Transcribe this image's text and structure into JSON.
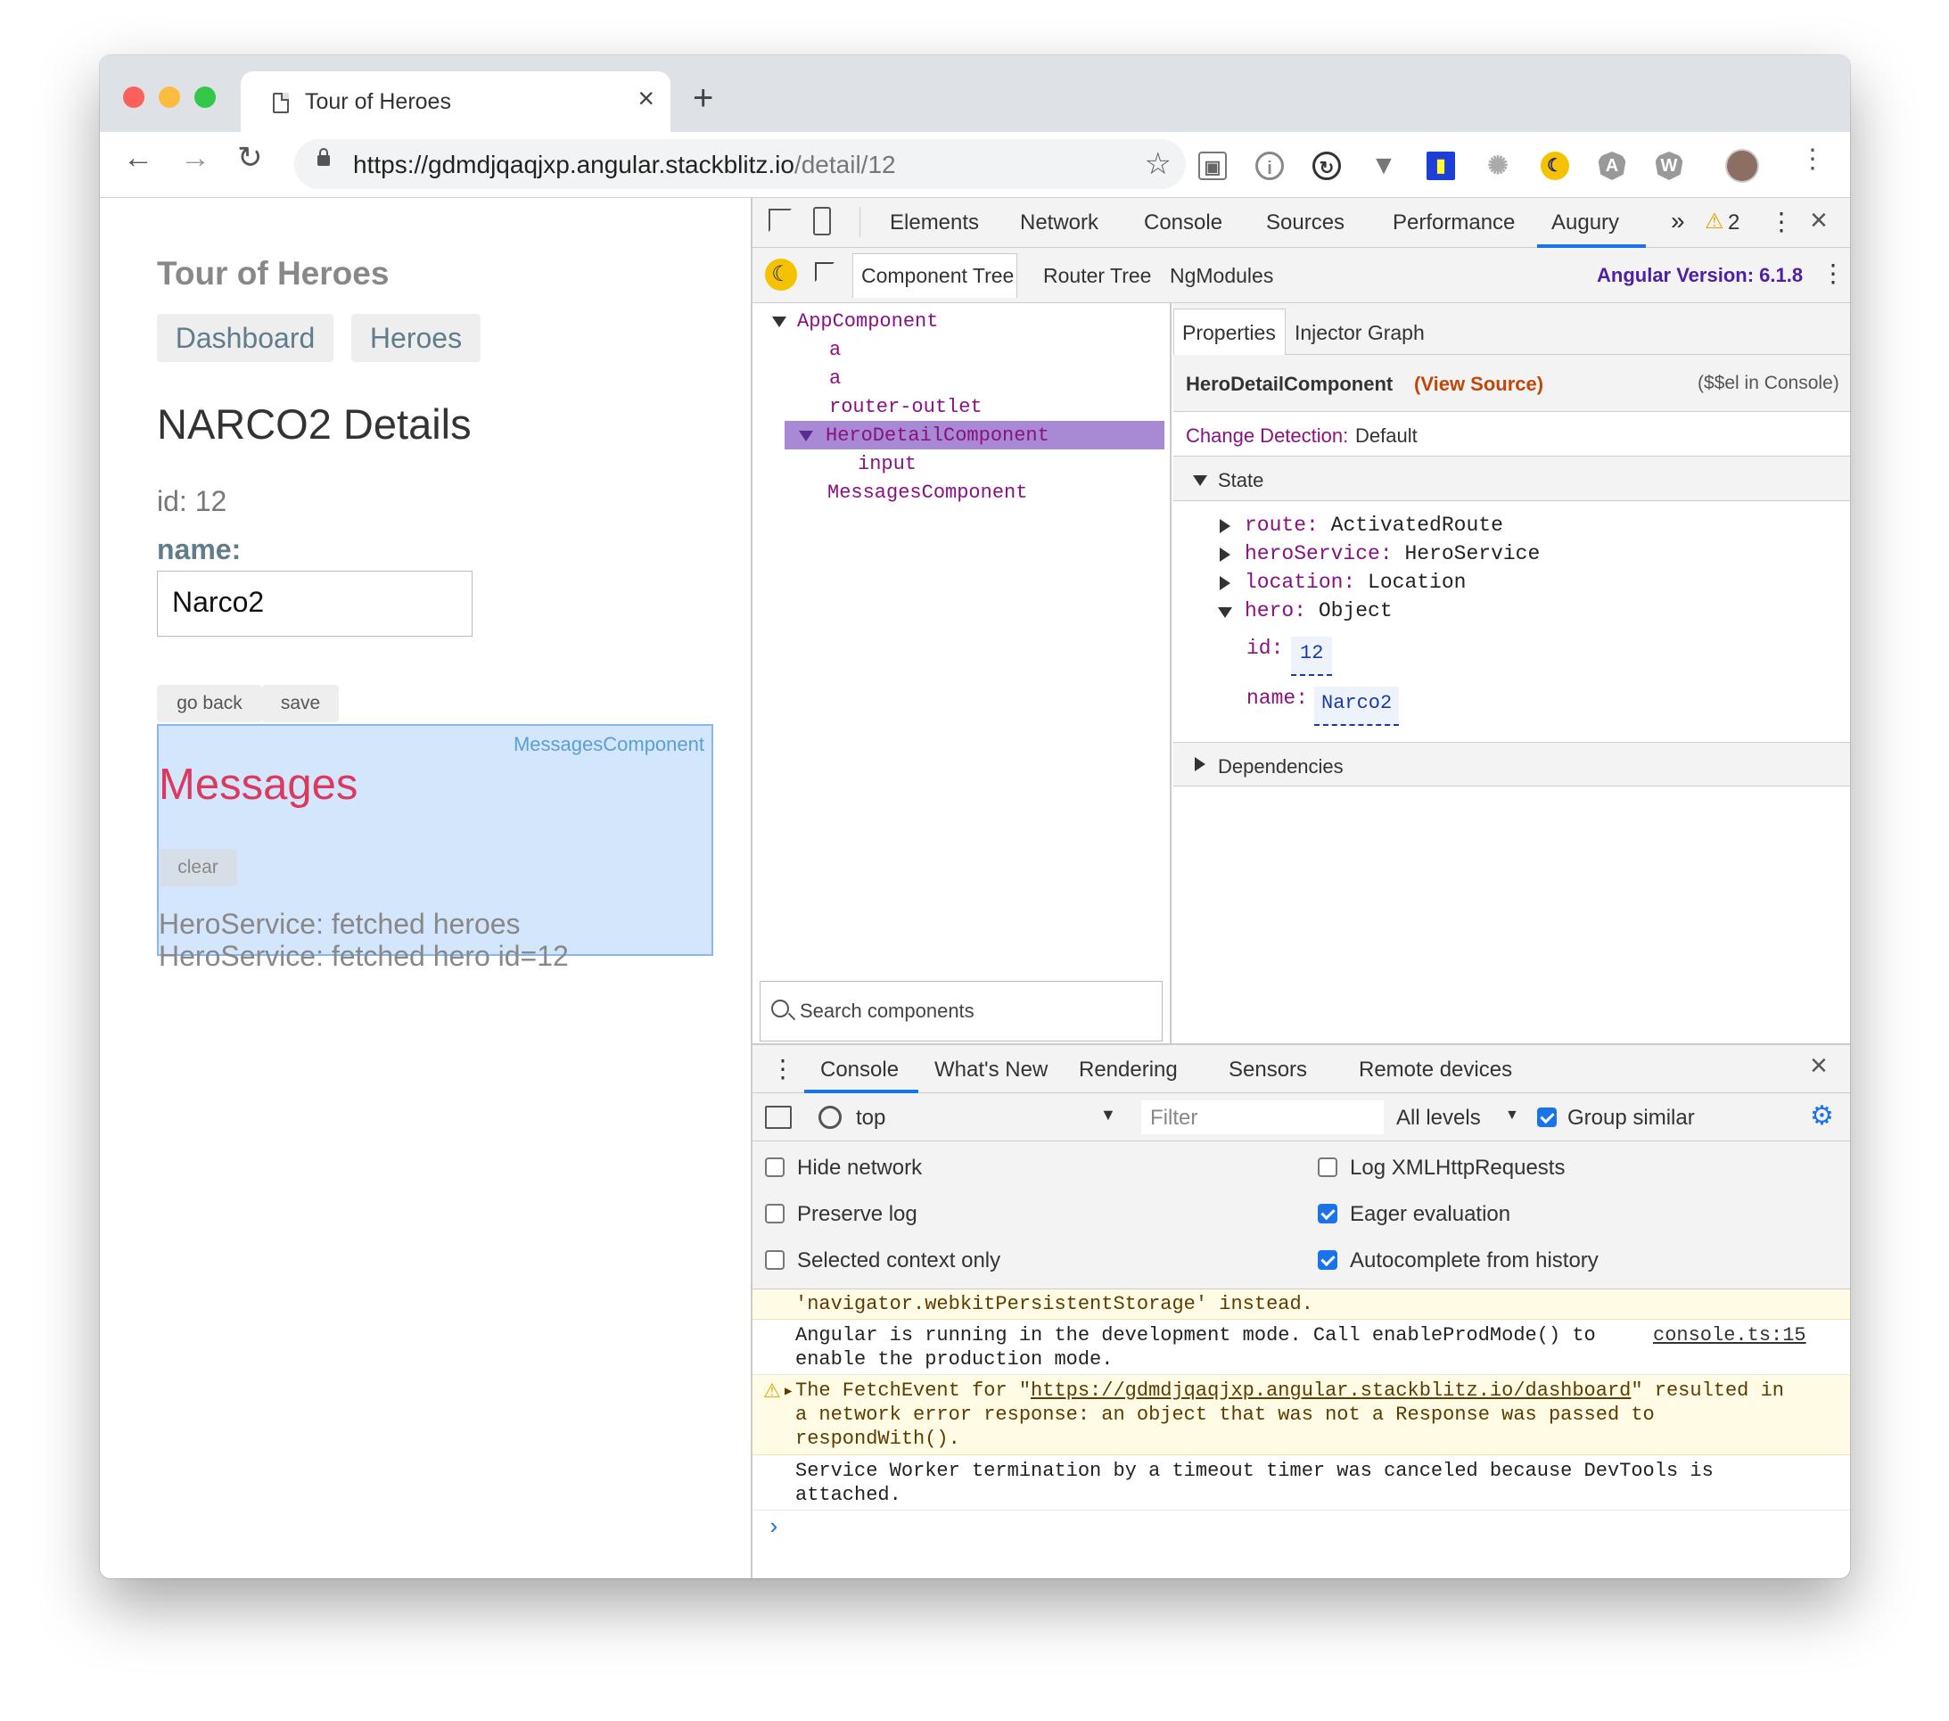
{
  "browser": {
    "tab_title": "Tour of Heroes",
    "url_main": "https://gdmdjqaqjxp.angular.stackblitz.io",
    "url_path": "/detail/12"
  },
  "app": {
    "title": "Tour of Heroes",
    "nav": [
      "Dashboard",
      "Heroes"
    ],
    "detail_title": "NARCO2 Details",
    "id_label": "id: 12",
    "name_label": "name:",
    "name_value": "Narco2",
    "go_back": "go back",
    "save": "save",
    "messages_component_label": "MessagesComponent",
    "messages_title": "Messages",
    "clear": "clear",
    "messages": [
      "HeroService: fetched heroes",
      "HeroService: fetched hero id=12"
    ]
  },
  "devtools": {
    "tabs": [
      "Elements",
      "Network",
      "Console",
      "Sources",
      "Performance",
      "Augury"
    ],
    "more": "»",
    "warning_count": "2",
    "augury": {
      "subtabs": [
        "Component Tree",
        "Router Tree",
        "NgModules"
      ],
      "angular_version": "Angular Version: 6.1.8",
      "tree": [
        "AppComponent",
        "a",
        "a",
        "router-outlet",
        "HeroDetailComponent",
        "input",
        "MessagesComponent"
      ],
      "search_placeholder": "Search components",
      "props_tabs": [
        "Properties",
        "Injector Graph"
      ],
      "component_name": "HeroDetailComponent",
      "view_source": "(View Source)",
      "console_ref": "($$el in Console)",
      "change_detection_label": "Change Detection:",
      "change_detection_value": "Default",
      "state_label": "State",
      "state": [
        {
          "key": "route:",
          "value": "ActivatedRoute"
        },
        {
          "key": "heroService:",
          "value": "HeroService"
        },
        {
          "key": "location:",
          "value": "Location"
        },
        {
          "key": "hero:",
          "value": "Object"
        }
      ],
      "hero_id_key": "id:",
      "hero_id_value": "12",
      "hero_name_key": "name:",
      "hero_name_value": "Narco2",
      "dependencies_label": "Dependencies"
    },
    "drawer": {
      "tabs": [
        "Console",
        "What's New",
        "Rendering",
        "Sensors",
        "Remote devices"
      ],
      "context": "top",
      "filter_placeholder": "Filter",
      "levels": "All levels",
      "group_similar": "Group similar",
      "settings_left": [
        "Hide network",
        "Preserve log",
        "Selected context only"
      ],
      "settings_right": [
        "Log XMLHttpRequests",
        "Eager evaluation",
        "Autocomplete from history"
      ],
      "log": {
        "line0": "'navigator.webkitPersistentStorage' instead.",
        "line1a": "Angular is running in the development mode. Call enableProdMode() to",
        "line1b": "enable the production mode.",
        "line1_src": "console.ts:15",
        "warn_a_prefix": "The FetchEvent for \"",
        "warn_link": "https://gdmdjqaqjxp.angular.stackblitz.io/dashboard",
        "warn_a_suffix": "\" resulted in",
        "warn_b": "a network error response: an object that was not a Response was passed to",
        "warn_c": "respondWith().",
        "line3a": "Service Worker termination by a timeout timer was canceled because DevTools is",
        "line3b": "attached.",
        "prompt": "›"
      }
    }
  }
}
